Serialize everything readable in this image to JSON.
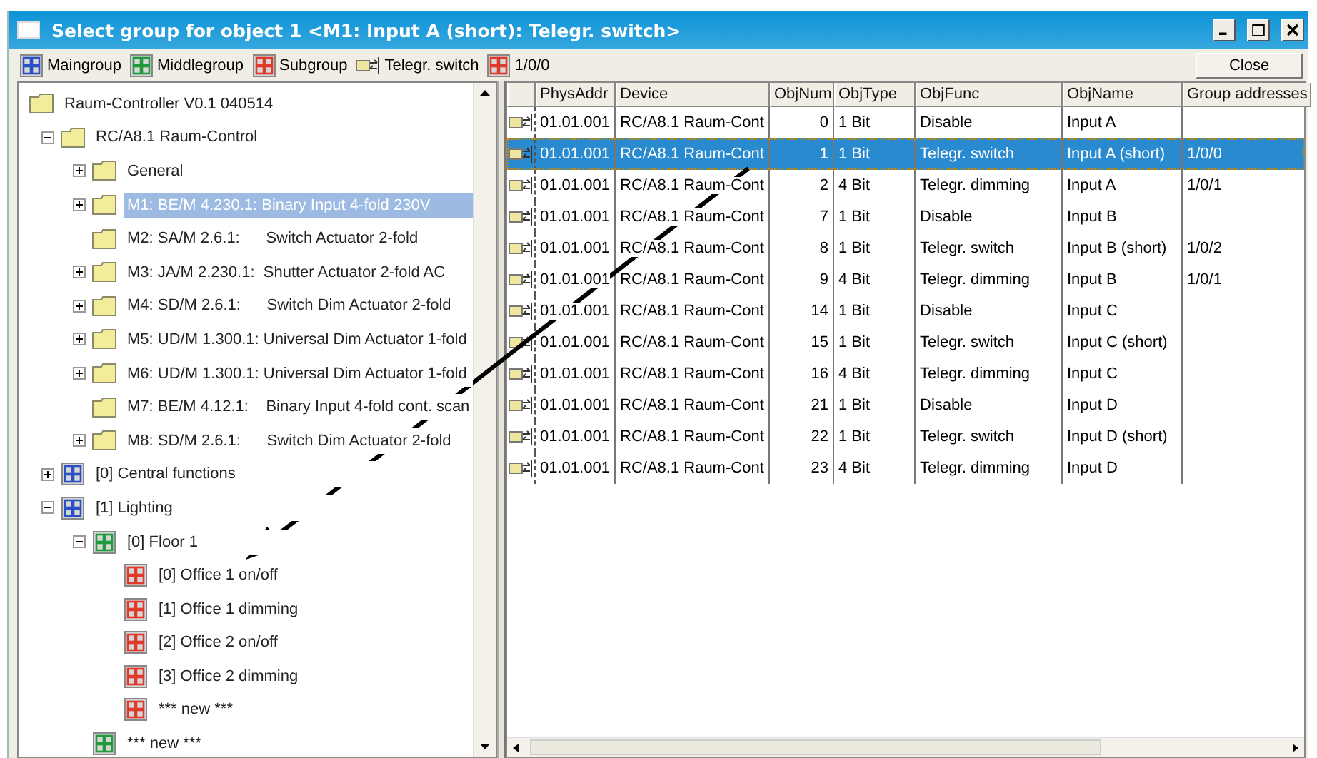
{
  "window": {
    "title": "Select group for object 1 <M1: Input A (short): Telegr. switch>"
  },
  "legend": [
    {
      "kind": "maingroup",
      "label": "Maingroup"
    },
    {
      "kind": "middlegroup",
      "label": "Middlegroup"
    },
    {
      "kind": "subgroup",
      "label": "Subgroup"
    },
    {
      "kind": "object",
      "label": "Telegr. switch"
    },
    {
      "kind": "subgroup",
      "label": "1/0/0"
    }
  ],
  "close_button": "Close",
  "tree": [
    {
      "kind": "device",
      "label": "Raum-Controller V0.1 040514",
      "selected": false,
      "children": [
        {
          "kind": "device",
          "label": "RC/A8.1 Raum-Control",
          "expanded": true,
          "selected": false,
          "children": [
            {
              "kind": "device",
              "label": "General",
              "expanded": false,
              "selected": false
            },
            {
              "kind": "device",
              "label": "M1: BE/M 4.230.1: Binary Input 4-fold 230V",
              "expanded": false,
              "selected": true
            },
            {
              "kind": "device",
              "label": "M2: SA/M 2.6.1:      Switch Actuator 2-fold",
              "selected": false
            },
            {
              "kind": "device",
              "label": "M3: JA/M 2.230.1:  Shutter Actuator 2-fold AC",
              "expanded": false,
              "selected": false
            },
            {
              "kind": "device",
              "label": "M4: SD/M 2.6.1:      Switch Dim Actuator 2-fold",
              "expanded": false,
              "selected": false
            },
            {
              "kind": "device",
              "label": "M5: UD/M 1.300.1: Universal Dim Actuator 1-fold",
              "expanded": false,
              "selected": false
            },
            {
              "kind": "device",
              "label": "M6: UD/M 1.300.1: Universal Dim Actuator 1-fold",
              "expanded": false,
              "selected": false
            },
            {
              "kind": "device",
              "label": "M7: BE/M 4.12.1:    Binary Input 4-fold cont. scan",
              "selected": false
            },
            {
              "kind": "device",
              "label": "M8: SD/M 2.6.1:      Switch Dim Actuator 2-fold",
              "expanded": false,
              "selected": false
            }
          ]
        },
        {
          "kind": "maingroup",
          "label": "[0] Central functions",
          "expanded": false,
          "selected": false
        },
        {
          "kind": "maingroup",
          "label": "[1] Lighting",
          "expanded": true,
          "selected": false,
          "children": [
            {
              "kind": "middlegroup",
              "label": "[0] Floor 1",
              "expanded": true,
              "selected": false,
              "children": [
                {
                  "kind": "subgroup",
                  "label": "[0] Office 1 on/off",
                  "selected": false
                },
                {
                  "kind": "subgroup",
                  "label": "[1] Office 1 dimming",
                  "selected": false
                },
                {
                  "kind": "subgroup",
                  "label": "[2] Office 2 on/off",
                  "selected": false
                },
                {
                  "kind": "subgroup",
                  "label": "[3] Office 2 dimming",
                  "selected": false
                },
                {
                  "kind": "subgroup",
                  "label": "*** new ***",
                  "selected": false
                }
              ]
            },
            {
              "kind": "middlegroup",
              "label": "*** new ***",
              "selected": false
            }
          ]
        }
      ]
    }
  ],
  "table": {
    "columns": [
      "PhysAddr",
      "Device",
      "ObjNum",
      "ObjType",
      "ObjFunc",
      "ObjName",
      "Group addresses"
    ],
    "rows": [
      {
        "selected": false,
        "cells": [
          "01.01.001",
          "RC/A8.1 Raum-Cont",
          "0",
          "1 Bit",
          "Disable",
          "Input A",
          ""
        ]
      },
      {
        "selected": true,
        "cells": [
          "01.01.001",
          "RC/A8.1 Raum-Cont",
          "1",
          "1 Bit",
          "Telegr. switch",
          "Input A (short)",
          "1/0/0"
        ]
      },
      {
        "selected": false,
        "cells": [
          "01.01.001",
          "RC/A8.1 Raum-Cont",
          "2",
          "4 Bit",
          "Telegr. dimming",
          "Input A",
          "1/0/1"
        ]
      },
      {
        "selected": false,
        "cells": [
          "01.01.001",
          "RC/A8.1 Raum-Cont",
          "7",
          "1 Bit",
          "Disable",
          "Input B",
          ""
        ]
      },
      {
        "selected": false,
        "cells": [
          "01.01.001",
          "RC/A8.1 Raum-Cont",
          "8",
          "1 Bit",
          "Telegr. switch",
          "Input B (short)",
          "1/0/2"
        ]
      },
      {
        "selected": false,
        "cells": [
          "01.01.001",
          "RC/A8.1 Raum-Cont",
          "9",
          "4 Bit",
          "Telegr. dimming",
          "Input B",
          "1/0/1"
        ]
      },
      {
        "selected": false,
        "cells": [
          "01.01.001",
          "RC/A8.1 Raum-Cont",
          "14",
          "1 Bit",
          "Disable",
          "Input C",
          ""
        ]
      },
      {
        "selected": false,
        "cells": [
          "01.01.001",
          "RC/A8.1 Raum-Cont",
          "15",
          "1 Bit",
          "Telegr. switch",
          "Input C (short)",
          ""
        ]
      },
      {
        "selected": false,
        "cells": [
          "01.01.001",
          "RC/A8.1 Raum-Cont",
          "16",
          "4 Bit",
          "Telegr. dimming",
          "Input C",
          ""
        ]
      },
      {
        "selected": false,
        "cells": [
          "01.01.001",
          "RC/A8.1 Raum-Cont",
          "21",
          "1 Bit",
          "Disable",
          "Input D",
          ""
        ]
      },
      {
        "selected": false,
        "cells": [
          "01.01.001",
          "RC/A8.1 Raum-Cont",
          "22",
          "1 Bit",
          "Telegr. switch",
          "Input D (short)",
          ""
        ]
      },
      {
        "selected": false,
        "cells": [
          "01.01.001",
          "RC/A8.1 Raum-Cont",
          "23",
          "4 Bit",
          "Telegr. dimming",
          "Input D",
          ""
        ]
      }
    ]
  }
}
